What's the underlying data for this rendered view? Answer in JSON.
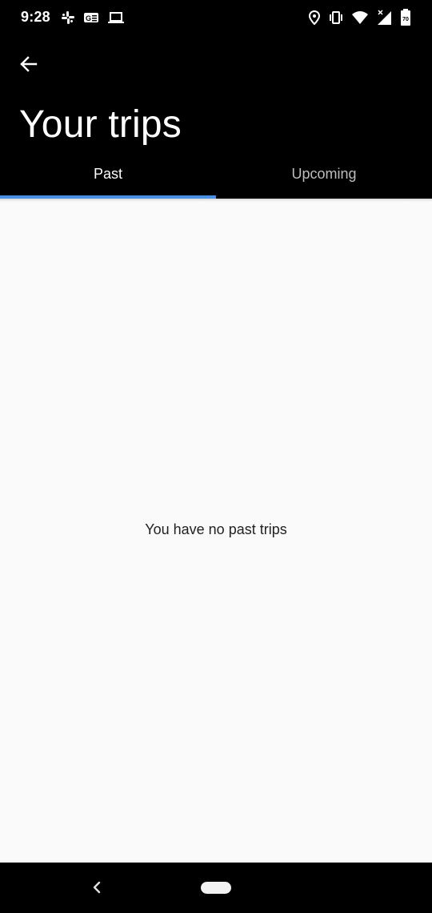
{
  "status_bar": {
    "time": "9:28",
    "left_icons": [
      "slack-icon",
      "news-icon",
      "laptop-icon"
    ],
    "right_icons": [
      "location-icon",
      "vibrate-icon",
      "wifi-icon",
      "signal-icon",
      "battery-icon"
    ],
    "battery_level": "70"
  },
  "app_bar": {
    "back_icon": "arrow-back-icon",
    "title": "Your trips"
  },
  "tabs": [
    {
      "label": "Past",
      "active": true
    },
    {
      "label": "Upcoming",
      "active": false
    }
  ],
  "colors": {
    "tab_indicator": "#4a90e2",
    "background": "#fafafa",
    "app_bar": "#000000"
  },
  "content": {
    "empty_message": "You have no past trips"
  },
  "nav_bar": {
    "back_icon": "nav-back-icon",
    "home_icon": "home-pill-icon"
  }
}
